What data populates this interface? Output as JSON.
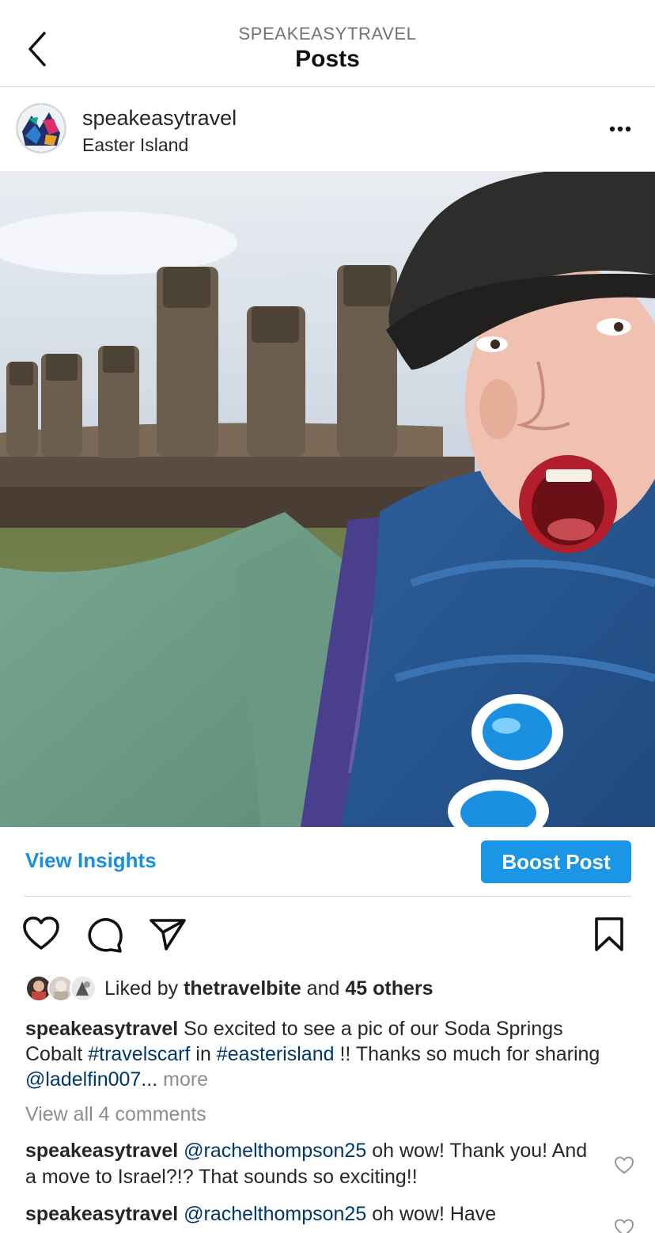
{
  "header": {
    "account": "SPEAKEASYTRAVEL",
    "title": "Posts"
  },
  "post": {
    "username": "speakeasytravel",
    "location": "Easter Island"
  },
  "actions": {
    "view_insights": "View Insights",
    "boost_post": "Boost Post"
  },
  "likes": {
    "prefix": "Liked by ",
    "user": "thetravelbite",
    "middle": " and ",
    "others": "45 others"
  },
  "caption": {
    "username": "speakeasytravel",
    "text1": " So excited to see a pic of our Soda Springs Cobalt ",
    "tag1": "#travelscarf",
    "text2": " in ",
    "tag2": "#easterisland",
    "text3": " !! Thanks so much for sharing ",
    "mention": "@ladelfin007",
    "ellipsis": "...",
    "more": " more"
  },
  "comments": {
    "view_all": "View all 4 comments",
    "items": [
      {
        "username": "speakeasytravel",
        "mention": "@rachelthompson25",
        "text": " oh wow! Thank you! And a move to Israel?!? That sounds so exciting!!"
      },
      {
        "username": "speakeasytravel",
        "mention": "@rachelthompson25",
        "text": " oh wow! Have"
      }
    ]
  },
  "icons": {
    "back": "chevron-left-icon",
    "more": "more-horizontal-icon",
    "like": "heart-icon",
    "comment": "comment-icon",
    "share": "send-icon",
    "save": "bookmark-icon"
  },
  "colors": {
    "link_blue": "#1a8fe0",
    "boost_bg": "#1b95e5",
    "hashtag": "#00376b",
    "muted": "#8e8e8e"
  }
}
